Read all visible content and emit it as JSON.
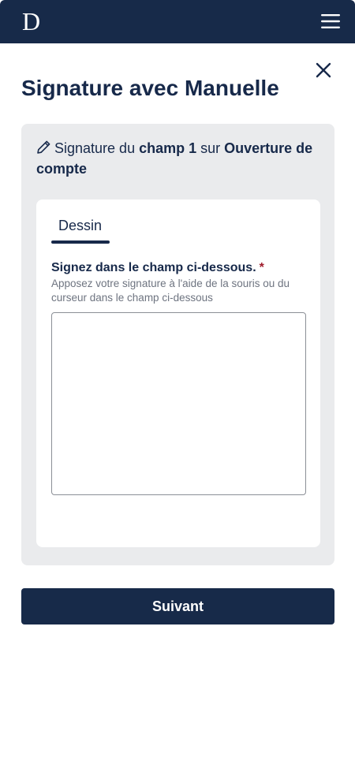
{
  "header": {
    "logo_text": "D",
    "background_color": "#172a49",
    "menu_icon": "hamburger-menu-icon"
  },
  "dialog": {
    "close_icon": "close-icon",
    "title": "Signature avec Manuelle"
  },
  "panel": {
    "heading_icon": "pencil-icon",
    "heading_prefix": "Signature du ",
    "heading_field": "champ 1",
    "heading_middle": " sur ",
    "heading_document": "Ouverture de compte"
  },
  "tabs": [
    {
      "label": "Dessin",
      "active": true
    }
  ],
  "signature_field": {
    "label": "Signez dans le champ ci-dessous.",
    "required_marker": "*",
    "help_text": "Apposez votre signature à l'aide de la souris ou du curseur dans le champ ci-dessous"
  },
  "actions": {
    "next_label": "Suivant"
  },
  "colors": {
    "primary": "#172a49",
    "panel_background": "#eaebed",
    "required": "#a01c2c",
    "muted_text": "#6e7480"
  }
}
